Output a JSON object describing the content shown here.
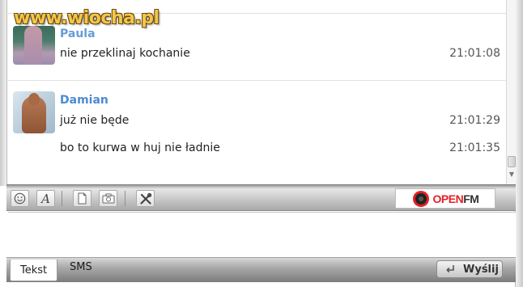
{
  "watermark": {
    "text": "www.wiocha.pl"
  },
  "chat": {
    "messages": [
      {
        "sender": "Paula",
        "text": "nie przeklinaj kochanie",
        "time": "21:01:08"
      },
      {
        "sender": "Damian",
        "text": "już nie będe",
        "time": "21:01:29"
      },
      {
        "sender": "",
        "text": "bo to kurwa w huj nie ładnie",
        "time": "21:01:35"
      }
    ]
  },
  "toolbar": {
    "buttons": [
      {
        "icon": "smiley-icon"
      },
      {
        "icon": "font-icon"
      },
      {
        "icon": "file-icon"
      },
      {
        "icon": "camera-icon"
      },
      {
        "icon": "tools-icon"
      }
    ],
    "font_glyph": "A"
  },
  "ad": {
    "brand_open": "OPEN",
    "brand_fm": "FM"
  },
  "input": {
    "value": ""
  },
  "tabs": [
    {
      "label": "Tekst",
      "active": true
    },
    {
      "label": "SMS",
      "active": false
    }
  ],
  "send_button": {
    "label": "Wyślij"
  },
  "colors": {
    "sender": "#4b8bd2",
    "openfm_red": "#e32027",
    "watermark": "#f2c74a"
  }
}
